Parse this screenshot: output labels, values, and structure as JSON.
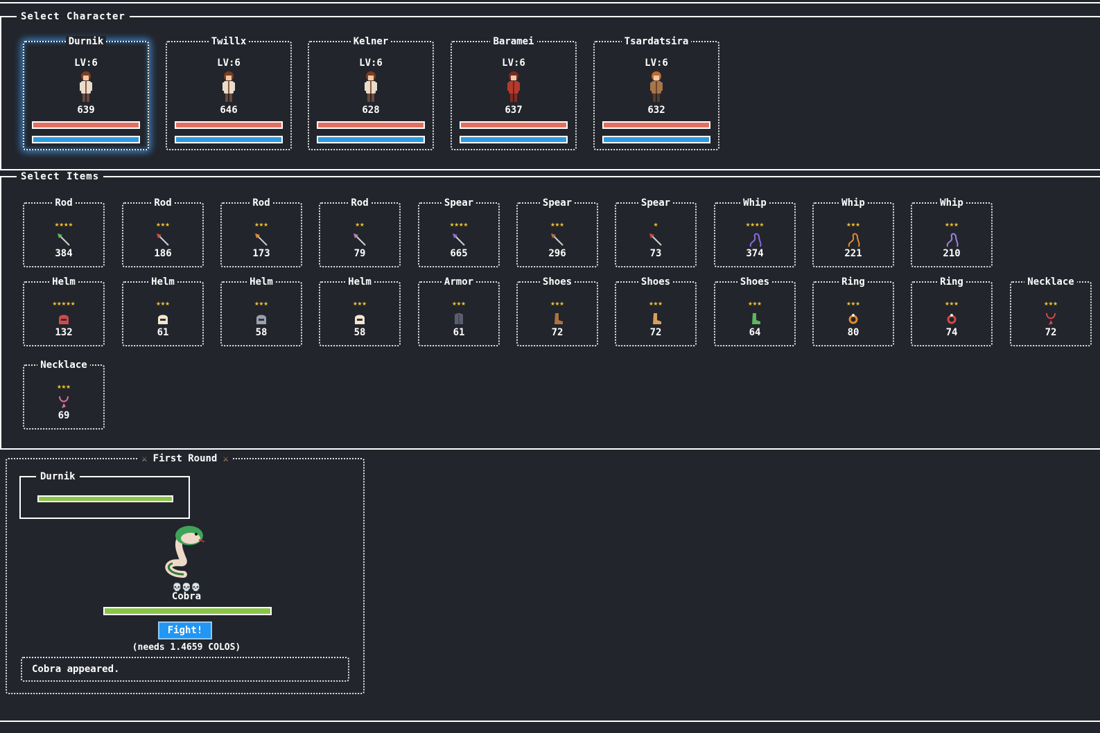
{
  "colors": {
    "background": "#22252b",
    "hp_bar": "#e07060",
    "mp_bar": "#2b9be0",
    "health_bar": "#8bc34a",
    "star": "#f2c230",
    "fight_button": "#2196f3",
    "selection_glow": "#3d7fc0"
  },
  "character_section": {
    "title": "Select Character",
    "characters": [
      {
        "name": "Durnik",
        "level": "LV:6",
        "power": "639",
        "selected": true,
        "sprite": "brown-hair-coat-sprite-icon",
        "hp_fill": 1.0,
        "mp_fill": 1.0
      },
      {
        "name": "Twillx",
        "level": "LV:6",
        "power": "646",
        "selected": false,
        "sprite": "brown-hair-coat-sprite-icon",
        "hp_fill": 1.0,
        "mp_fill": 1.0
      },
      {
        "name": "Kelner",
        "level": "LV:6",
        "power": "628",
        "selected": false,
        "sprite": "brown-hair-coat-sprite-icon",
        "hp_fill": 1.0,
        "mp_fill": 1.0
      },
      {
        "name": "Baramei",
        "level": "LV:6",
        "power": "637",
        "selected": false,
        "sprite": "red-robe-sprite-icon",
        "hp_fill": 1.0,
        "mp_fill": 1.0
      },
      {
        "name": "Tsardatsira",
        "level": "LV:6",
        "power": "632",
        "selected": false,
        "sprite": "orange-hair-sprite-icon",
        "hp_fill": 1.0,
        "mp_fill": 1.0
      }
    ]
  },
  "items_section": {
    "title": "Select Items",
    "items": [
      {
        "name": "Rod",
        "stars": "★★★★",
        "value": "384",
        "icon": "green-rod-icon"
      },
      {
        "name": "Rod",
        "stars": "★★★",
        "value": "186",
        "icon": "red-rod-icon"
      },
      {
        "name": "Rod",
        "stars": "★★★",
        "value": "173",
        "icon": "orange-rod-icon"
      },
      {
        "name": "Rod",
        "stars": "★★",
        "value": "79",
        "icon": "mace-rod-icon"
      },
      {
        "name": "Spear",
        "stars": "★★★★",
        "value": "665",
        "icon": "purple-spear-icon"
      },
      {
        "name": "Spear",
        "stars": "★★★",
        "value": "296",
        "icon": "brown-spear-icon"
      },
      {
        "name": "Spear",
        "stars": "★",
        "value": "73",
        "icon": "red-spear-icon"
      },
      {
        "name": "Whip",
        "stars": "★★★★",
        "value": "374",
        "icon": "purple-whip-icon"
      },
      {
        "name": "Whip",
        "stars": "★★★",
        "value": "221",
        "icon": "orange-whip-icon"
      },
      {
        "name": "Whip",
        "stars": "★★★",
        "value": "210",
        "icon": "violet-whip-icon"
      },
      {
        "name": "Helm",
        "stars": "★★★★★",
        "value": "132",
        "icon": "red-helm-icon"
      },
      {
        "name": "Helm",
        "stars": "★★★",
        "value": "61",
        "icon": "white-helm-icon"
      },
      {
        "name": "Helm",
        "stars": "★★★",
        "value": "58",
        "icon": "steel-helm-icon"
      },
      {
        "name": "Helm",
        "stars": "★★★",
        "value": "58",
        "icon": "white-helm-icon"
      },
      {
        "name": "Armor",
        "stars": "★★★",
        "value": "61",
        "icon": "dark-armor-icon"
      },
      {
        "name": "Shoes",
        "stars": "★★★",
        "value": "72",
        "icon": "brown-boot-icon"
      },
      {
        "name": "Shoes",
        "stars": "★★★",
        "value": "72",
        "icon": "tan-boot-icon"
      },
      {
        "name": "Shoes",
        "stars": "★★★",
        "value": "64",
        "icon": "green-shoe-icon"
      },
      {
        "name": "Ring",
        "stars": "★★★",
        "value": "80",
        "icon": "orange-ring-icon"
      },
      {
        "name": "Ring",
        "stars": "★★★",
        "value": "74",
        "icon": "red-ring-icon"
      },
      {
        "name": "Necklace",
        "stars": "★★★",
        "value": "72",
        "icon": "red-necklace-icon"
      },
      {
        "name": "Necklace",
        "stars": "★★★",
        "value": "69",
        "icon": "pink-necklace-icon"
      }
    ]
  },
  "battle": {
    "title": "First Round",
    "title_icon": "crossed-swords-icon",
    "player_name": "Durnik",
    "player_hp_fill": 1.0,
    "enemy_level_marks": "💀💀💀",
    "enemy_name": "Cobra",
    "enemy_hp_fill": 1.0,
    "fight_label": "Fight!",
    "requirement": "(needs 1.4659 COLOS)",
    "log_message": "Cobra appeared."
  }
}
